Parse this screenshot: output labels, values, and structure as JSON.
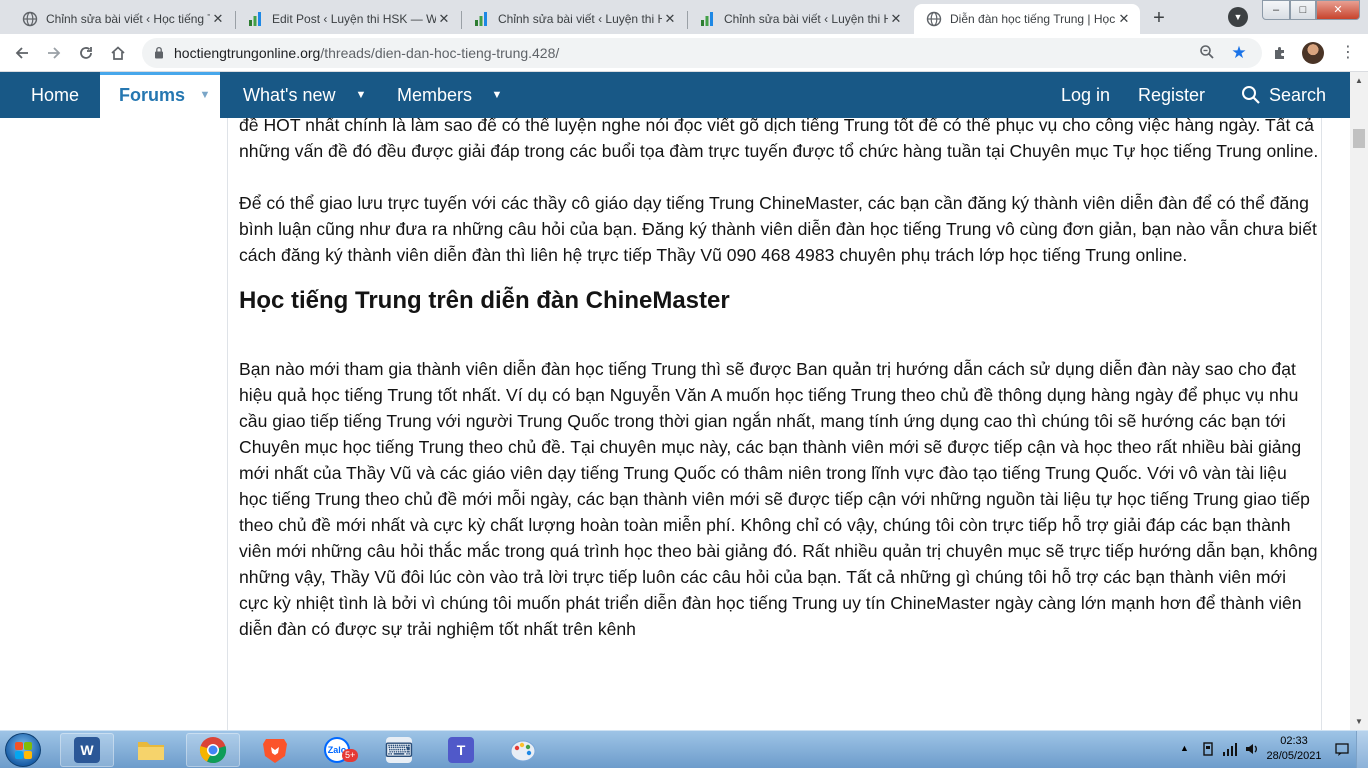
{
  "browser": {
    "tabs": [
      {
        "title": "Chỉnh sửa bài viết ‹ Học tiếng Trung",
        "icon": "globe-icon",
        "active": false
      },
      {
        "title": "Edit Post ‹ Luyện thi HSK — WordPress",
        "icon": "chart-favicon-icon",
        "active": false
      },
      {
        "title": "Chỉnh sửa bài viết ‹ Luyện thi HSK",
        "icon": "chart-favicon-icon",
        "active": false
      },
      {
        "title": "Chỉnh sửa bài viết ‹ Luyện thi HSK",
        "icon": "chart-favicon-icon",
        "active": false
      },
      {
        "title": "Diễn đàn học tiếng Trung | Học tiếng Trung",
        "icon": "globe-icon",
        "active": true
      }
    ],
    "new_tab_symbol": "+",
    "close_symbol": "✕",
    "url_host": "hoctiengtrungonline.org",
    "url_path": "/threads/dien-dan-hoc-tieng-trung.428/",
    "window_controls": {
      "minimize": "–",
      "maximize": "□",
      "close": "✕"
    }
  },
  "forum_nav": {
    "left_items": [
      {
        "label": "Home",
        "active": false,
        "has_dropdown": false
      },
      {
        "label": "Forums",
        "active": true,
        "has_dropdown": true
      },
      {
        "label": "What's new",
        "active": false,
        "has_dropdown": true
      },
      {
        "label": "Members",
        "active": false,
        "has_dropdown": true
      }
    ],
    "right_items": {
      "login": "Log in",
      "register": "Register",
      "search": "Search"
    },
    "caret_symbol": "▼",
    "colors": {
      "bar": "#185886",
      "active_text": "#2577b1",
      "active_accent": "#47a7eb"
    }
  },
  "article": {
    "paragraph_1": "phương pháp học tiếng Trung hiệu quả, các mẹo để nhớ mặt chữ Hán, cách học từ vựng tiếng Trung như thế nào sao cho nhớ được nhiều hơn và lâu hơn cũng như có thể vận dụng linh hoạt được những từ vựng đó vào trong thực tế giao tiếp hàng ngày .v.v. Trong đó chủ đề HOT nhất chính là làm sao để có thể luyện nghe nói đọc viết gõ dịch tiếng Trung tốt để có thể phục vụ cho công việc hàng ngày. Tất cả những vấn đề đó đều được giải đáp trong các buổi tọa đàm trực tuyến được tổ chức hàng tuần tại Chuyên mục Tự học tiếng Trung online.",
    "paragraph_2": "Để có thể giao lưu trực tuyến với các thầy cô giáo dạy tiếng Trung ChineMaster, các bạn cần đăng ký thành viên diễn đàn để có thể đăng bình luận cũng như đưa ra những câu hỏi của bạn. Đăng ký thành viên diễn đàn học tiếng Trung vô cùng đơn giản, bạn nào vẫn chưa biết cách đăng ký thành viên diễn đàn thì liên hệ trực tiếp Thầy Vũ 090 468 4983 chuyên phụ trách lớp học tiếng Trung online.",
    "heading": "Học tiếng Trung trên diễn đàn ChineMaster",
    "paragraph_3": "Bạn nào mới tham gia thành viên diễn đàn học tiếng Trung thì sẽ được Ban quản trị hướng dẫn cách sử dụng diễn đàn này sao cho đạt hiệu quả học tiếng Trung tốt nhất. Ví dụ có bạn Nguyễn Văn A muốn học tiếng Trung theo chủ đề thông dụng hàng ngày để phục vụ nhu cầu giao tiếp tiếng Trung với người Trung Quốc trong thời gian ngắn nhất, mang tính ứng dụng cao thì chúng tôi sẽ hướng các bạn tới Chuyên mục học tiếng Trung theo chủ đề. Tại chuyên mục này, các bạn thành viên mới sẽ được tiếp cận và học theo rất nhiều bài giảng mới nhất của Thầy Vũ và các giáo viên dạy tiếng Trung Quốc có thâm niên trong lĩnh vực đào tạo tiếng Trung Quốc. Với vô vàn tài liệu học tiếng Trung theo chủ đề mới mỗi ngày, các bạn thành viên mới sẽ được tiếp cận với những nguồn tài liệu tự học tiếng Trung giao tiếp theo chủ đề mới nhất và cực kỳ chất lượng hoàn toàn miễn phí. Không chỉ có vậy, chúng tôi còn trực tiếp hỗ trợ giải đáp các bạn thành viên mới những câu hỏi thắc mắc trong quá trình học theo bài giảng đó. Rất nhiều quản trị chuyên mục sẽ trực tiếp hướng dẫn bạn, không những vậy, Thầy Vũ đôi lúc còn vào trả lời trực tiếp luôn các câu hỏi của bạn. Tất cả những gì chúng tôi hỗ trợ các bạn thành viên mới cực kỳ nhiệt tình là bởi vì chúng tôi muốn phát triển diễn đàn học tiếng Trung uy tín ChineMaster ngày càng lớn mạnh hơn để thành viên diễn đàn có được sự trải nghiệm tốt nhất trên kênh"
  },
  "taskbar": {
    "apps": [
      {
        "name": "word",
        "icon": "word-icon",
        "glyph": "W",
        "color": "#2b5797",
        "running": true
      },
      {
        "name": "explorer",
        "icon": "folder-icon",
        "glyph": "",
        "color": "#e8b93c",
        "running": false
      },
      {
        "name": "chrome",
        "icon": "chrome-icon",
        "glyph": "",
        "color": "#db4437",
        "running": true
      },
      {
        "name": "brave",
        "icon": "brave-icon",
        "glyph": "",
        "color": "#fb542b",
        "running": false
      },
      {
        "name": "zalo",
        "icon": "zalo-icon",
        "glyph": "Zalo",
        "color": "#0068ff",
        "running": false,
        "badge": "5+"
      },
      {
        "name": "keyboard",
        "icon": "keyboard-icon",
        "glyph": "⌨",
        "color": "#5a7fa8",
        "running": false
      },
      {
        "name": "teams",
        "icon": "teams-icon",
        "glyph": "T",
        "color": "#5059c9",
        "running": false
      },
      {
        "name": "paint",
        "icon": "paint-icon",
        "glyph": "",
        "color": "#7aa7d8",
        "running": false
      }
    ],
    "tray_up": "▲",
    "clock_time": "02:33",
    "clock_date": "28/05/2021"
  }
}
